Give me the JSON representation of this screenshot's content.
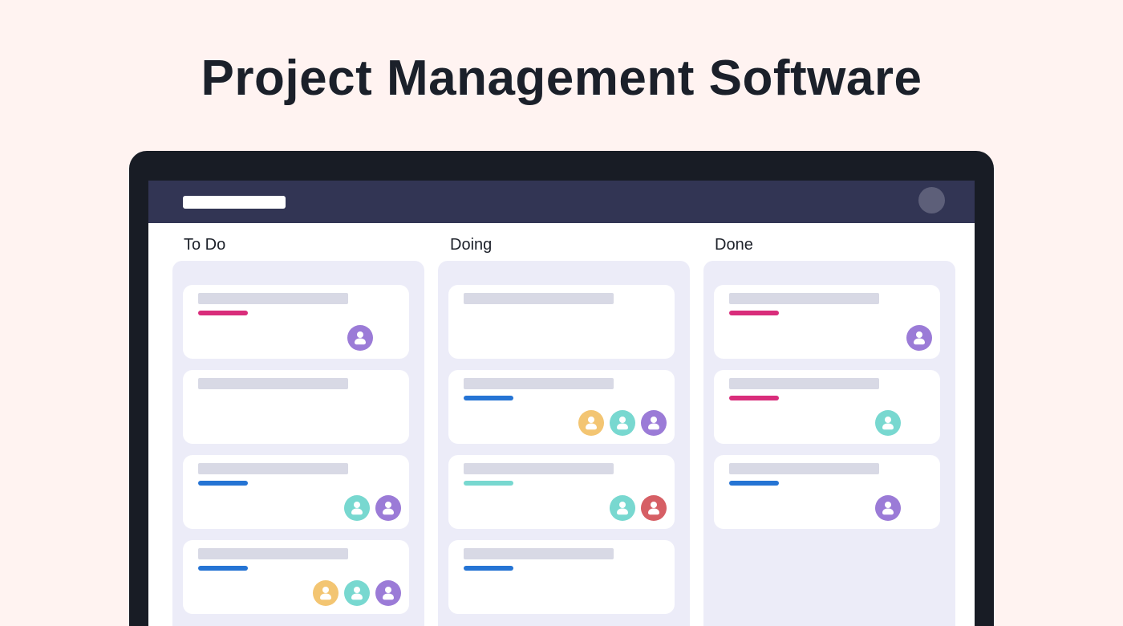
{
  "page_title": "Project Management Software",
  "colors": {
    "background": "#fff3f1",
    "device_frame": "#181c25",
    "app_header": "#323554",
    "column_bg": "#ececf8",
    "tag_pink": "#d92d7b",
    "tag_blue": "#2574d4",
    "tag_teal": "#78d8d0",
    "avatar_purple": "#9b7bd7",
    "avatar_teal": "#78d8d0",
    "avatar_yellow": "#f3c572",
    "avatar_red": "#d65f65"
  },
  "app": {
    "header": {
      "logo": "logo-placeholder",
      "profile_icon": "profile-avatar"
    },
    "board": {
      "columns": [
        {
          "title": "To Do",
          "cards": [
            {
              "tag": "#d92d7b",
              "assignees": [
                "#9b7bd7"
              ]
            },
            {
              "tag": "",
              "assignees": []
            },
            {
              "tag": "#2574d4",
              "assignees": [
                "#78d8d0",
                "#9b7bd7"
              ]
            },
            {
              "tag": "#2574d4",
              "assignees": [
                "#f3c572",
                "#78d8d0",
                "#9b7bd7"
              ]
            }
          ]
        },
        {
          "title": "Doing",
          "cards": [
            {
              "tag": "",
              "assignees": []
            },
            {
              "tag": "#2574d4",
              "assignees": [
                "#f3c572",
                "#78d8d0",
                "#9b7bd7"
              ]
            },
            {
              "tag": "#78d8d0",
              "assignees": [
                "#78d8d0",
                "#d65f65"
              ]
            },
            {
              "tag": "#2574d4",
              "assignees": []
            }
          ]
        },
        {
          "title": "Done",
          "cards": [
            {
              "tag": "#d92d7b",
              "assignees": [
                "#9b7bd7"
              ]
            },
            {
              "tag": "#d92d7b",
              "assignees": [
                "#78d8d0"
              ]
            },
            {
              "tag": "#2574d4",
              "assignees": [
                "#9b7bd7"
              ]
            }
          ]
        }
      ]
    }
  }
}
